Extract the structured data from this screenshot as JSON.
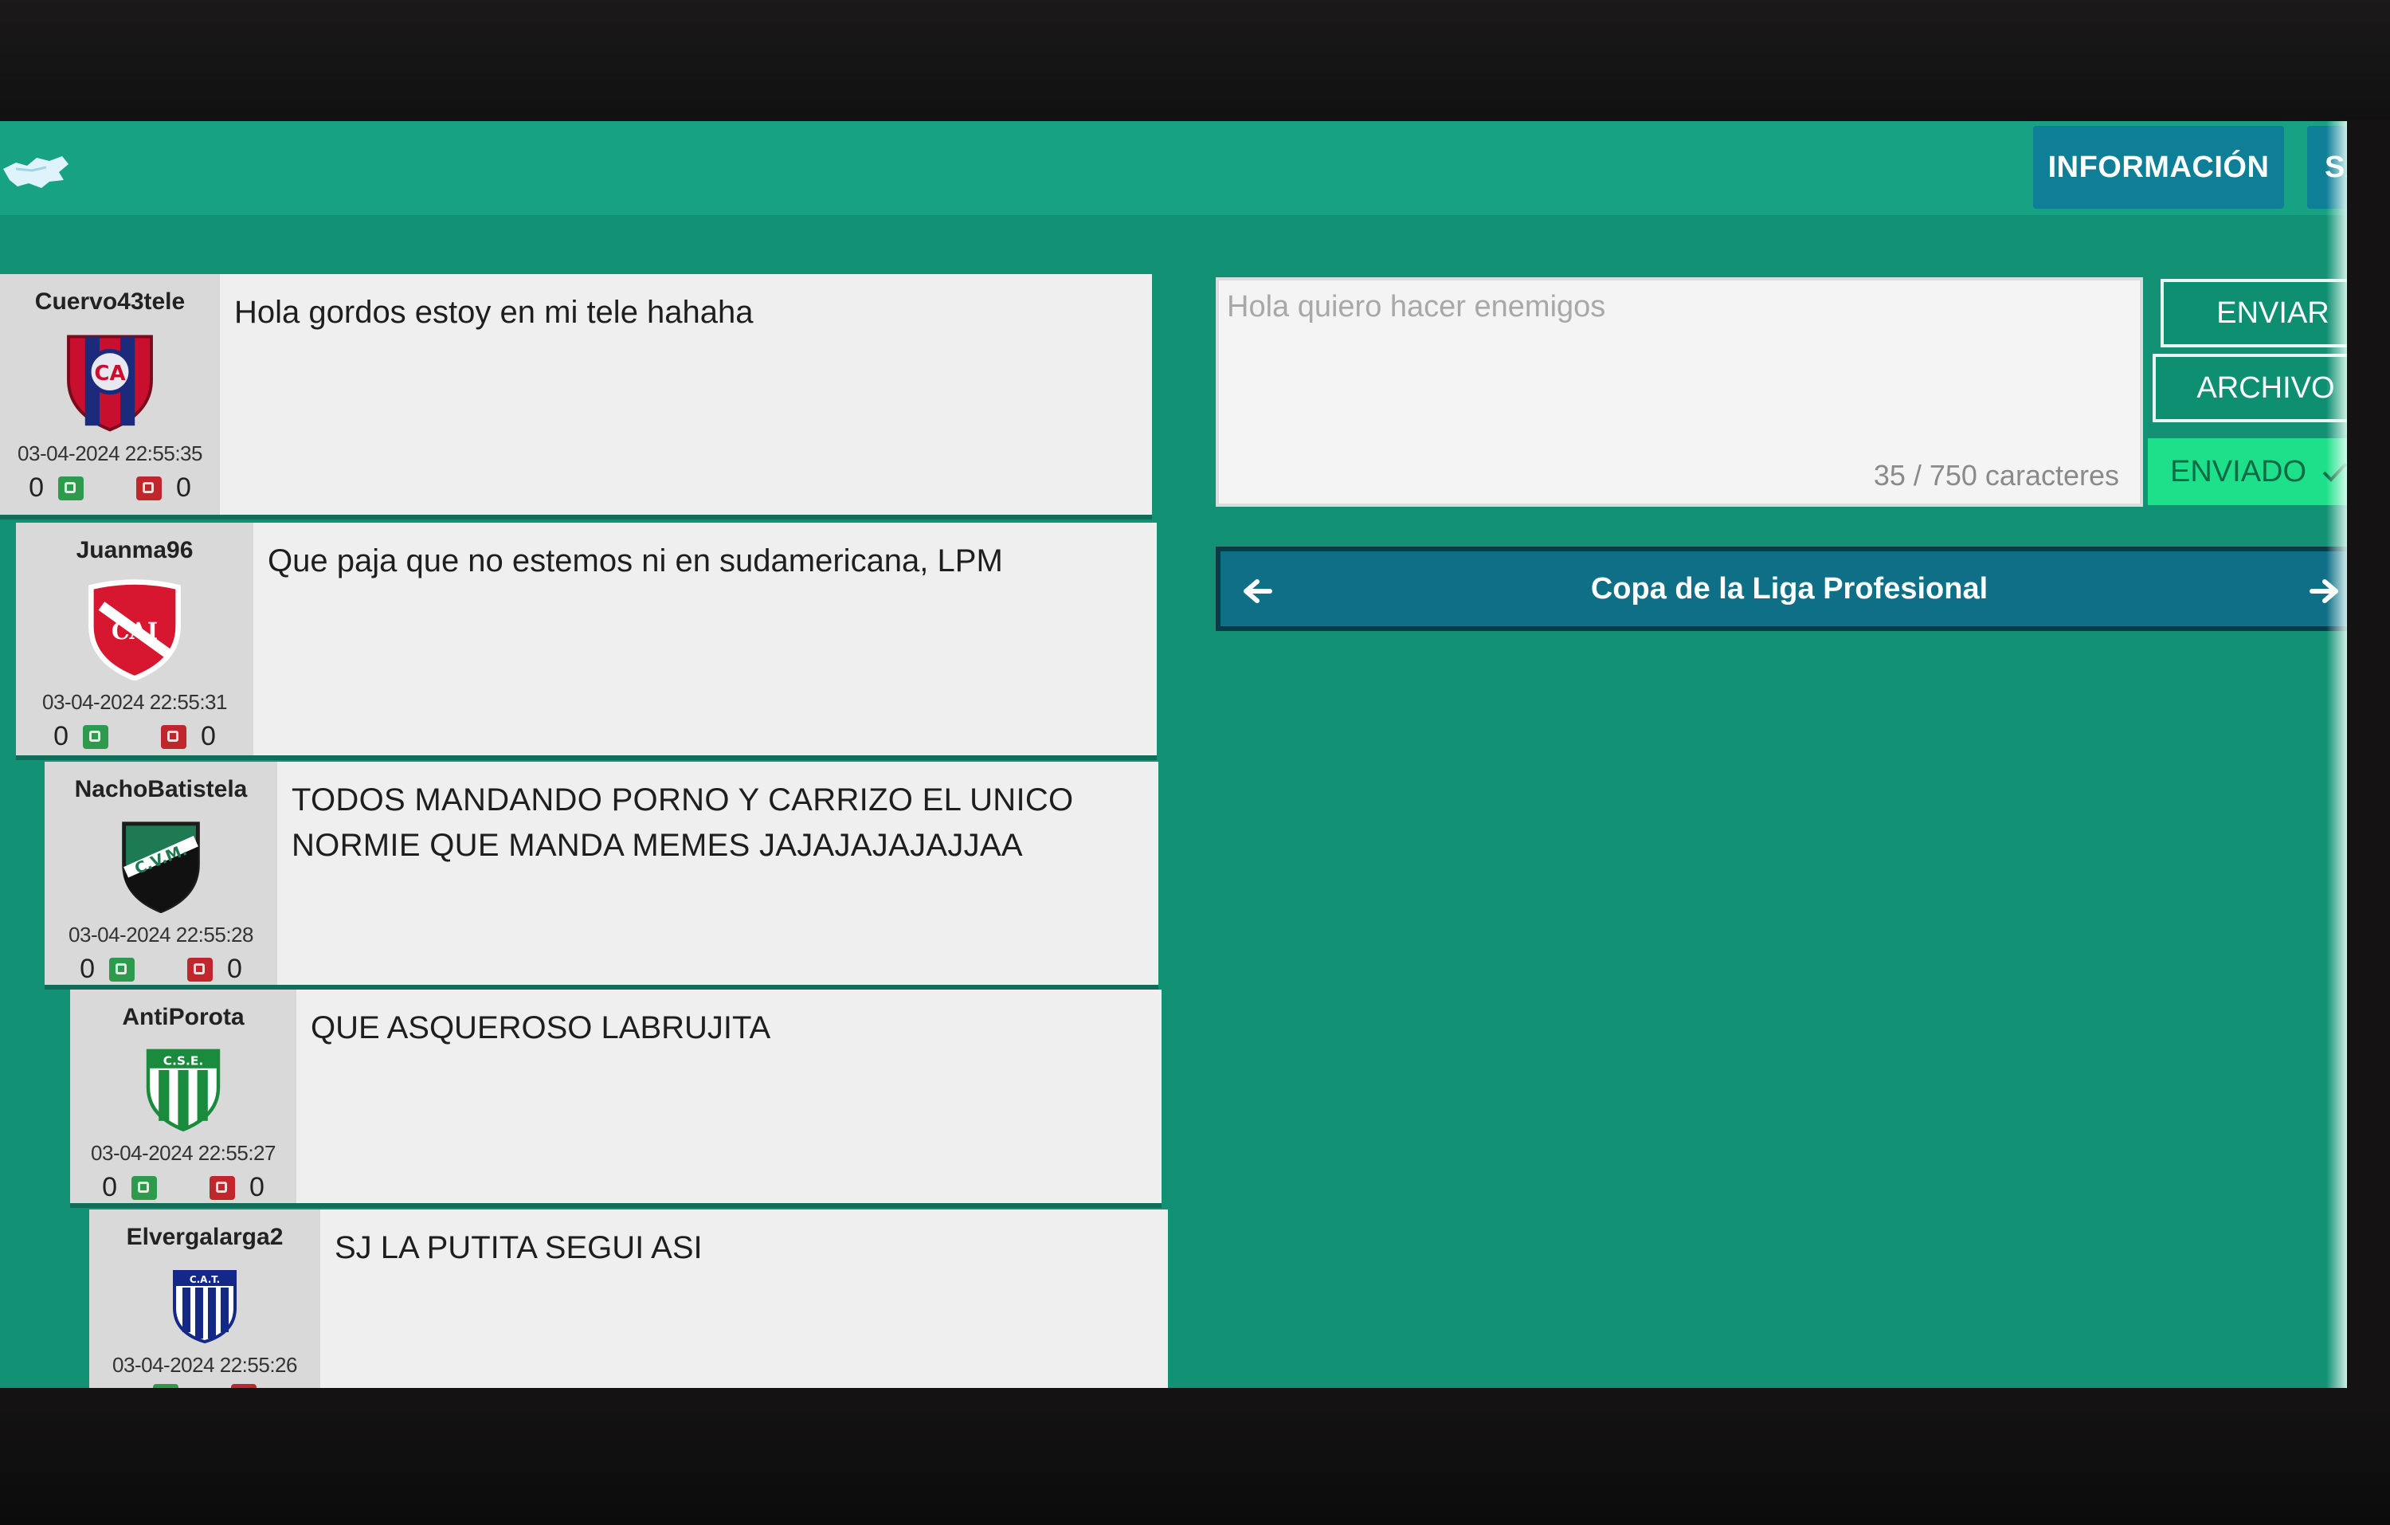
{
  "header": {
    "info_label": "INFORMACIÓN",
    "exit_label": "SALI"
  },
  "messages": [
    {
      "user": "Cuervo43tele",
      "text": "Hola gordos estoy en mi tele hahaha",
      "time": "03-04-2024 22:55:35",
      "up": "0",
      "down": "0",
      "badge": "san-lorenzo-badge-icon"
    },
    {
      "user": "Juanma96",
      "text": "Que paja que no estemos ni en sudamericana, LPM",
      "time": "03-04-2024 22:55:31",
      "up": "0",
      "down": "0",
      "badge": "independiente-badge-icon"
    },
    {
      "user": "NachoBatistela",
      "text": "TODOS MANDANDO PORNO Y CARRIZO EL UNICO NORMIE QUE MANDA MEMES JAJAJAJAJAJJAA",
      "time": "03-04-2024 22:55:28",
      "up": "0",
      "down": "0",
      "badge": "villa-mitre-badge-icon"
    },
    {
      "user": "AntiPorota",
      "text": "QUE ASQUEROSO LABRUJITA",
      "time": "03-04-2024 22:55:27",
      "up": "0",
      "down": "0",
      "badge": "sportivo-estudiantes-badge-icon"
    },
    {
      "user": "Elvergalarga2",
      "text": "SJ LA PUTITA SEGUI ASI",
      "time": "03-04-2024 22:55:26",
      "up": "",
      "down": "",
      "badge": "talleres-badge-icon"
    }
  ],
  "composer": {
    "text": "Hola quiero hacer enemigos",
    "count": "35 / 750 caracteres",
    "send_label": "ENVIAR",
    "file_label": "ARCHIVO",
    "sent_label": "ENVIADO"
  },
  "league": {
    "name": "Copa de la Liga Profesional"
  },
  "colors": {
    "screen_bg": "#129174",
    "topbar": "#16a283",
    "button_blue": "#0f7f97",
    "sent_green": "#1fe08a",
    "upvote": "#2e9a4e",
    "downvote": "#c0272d"
  }
}
